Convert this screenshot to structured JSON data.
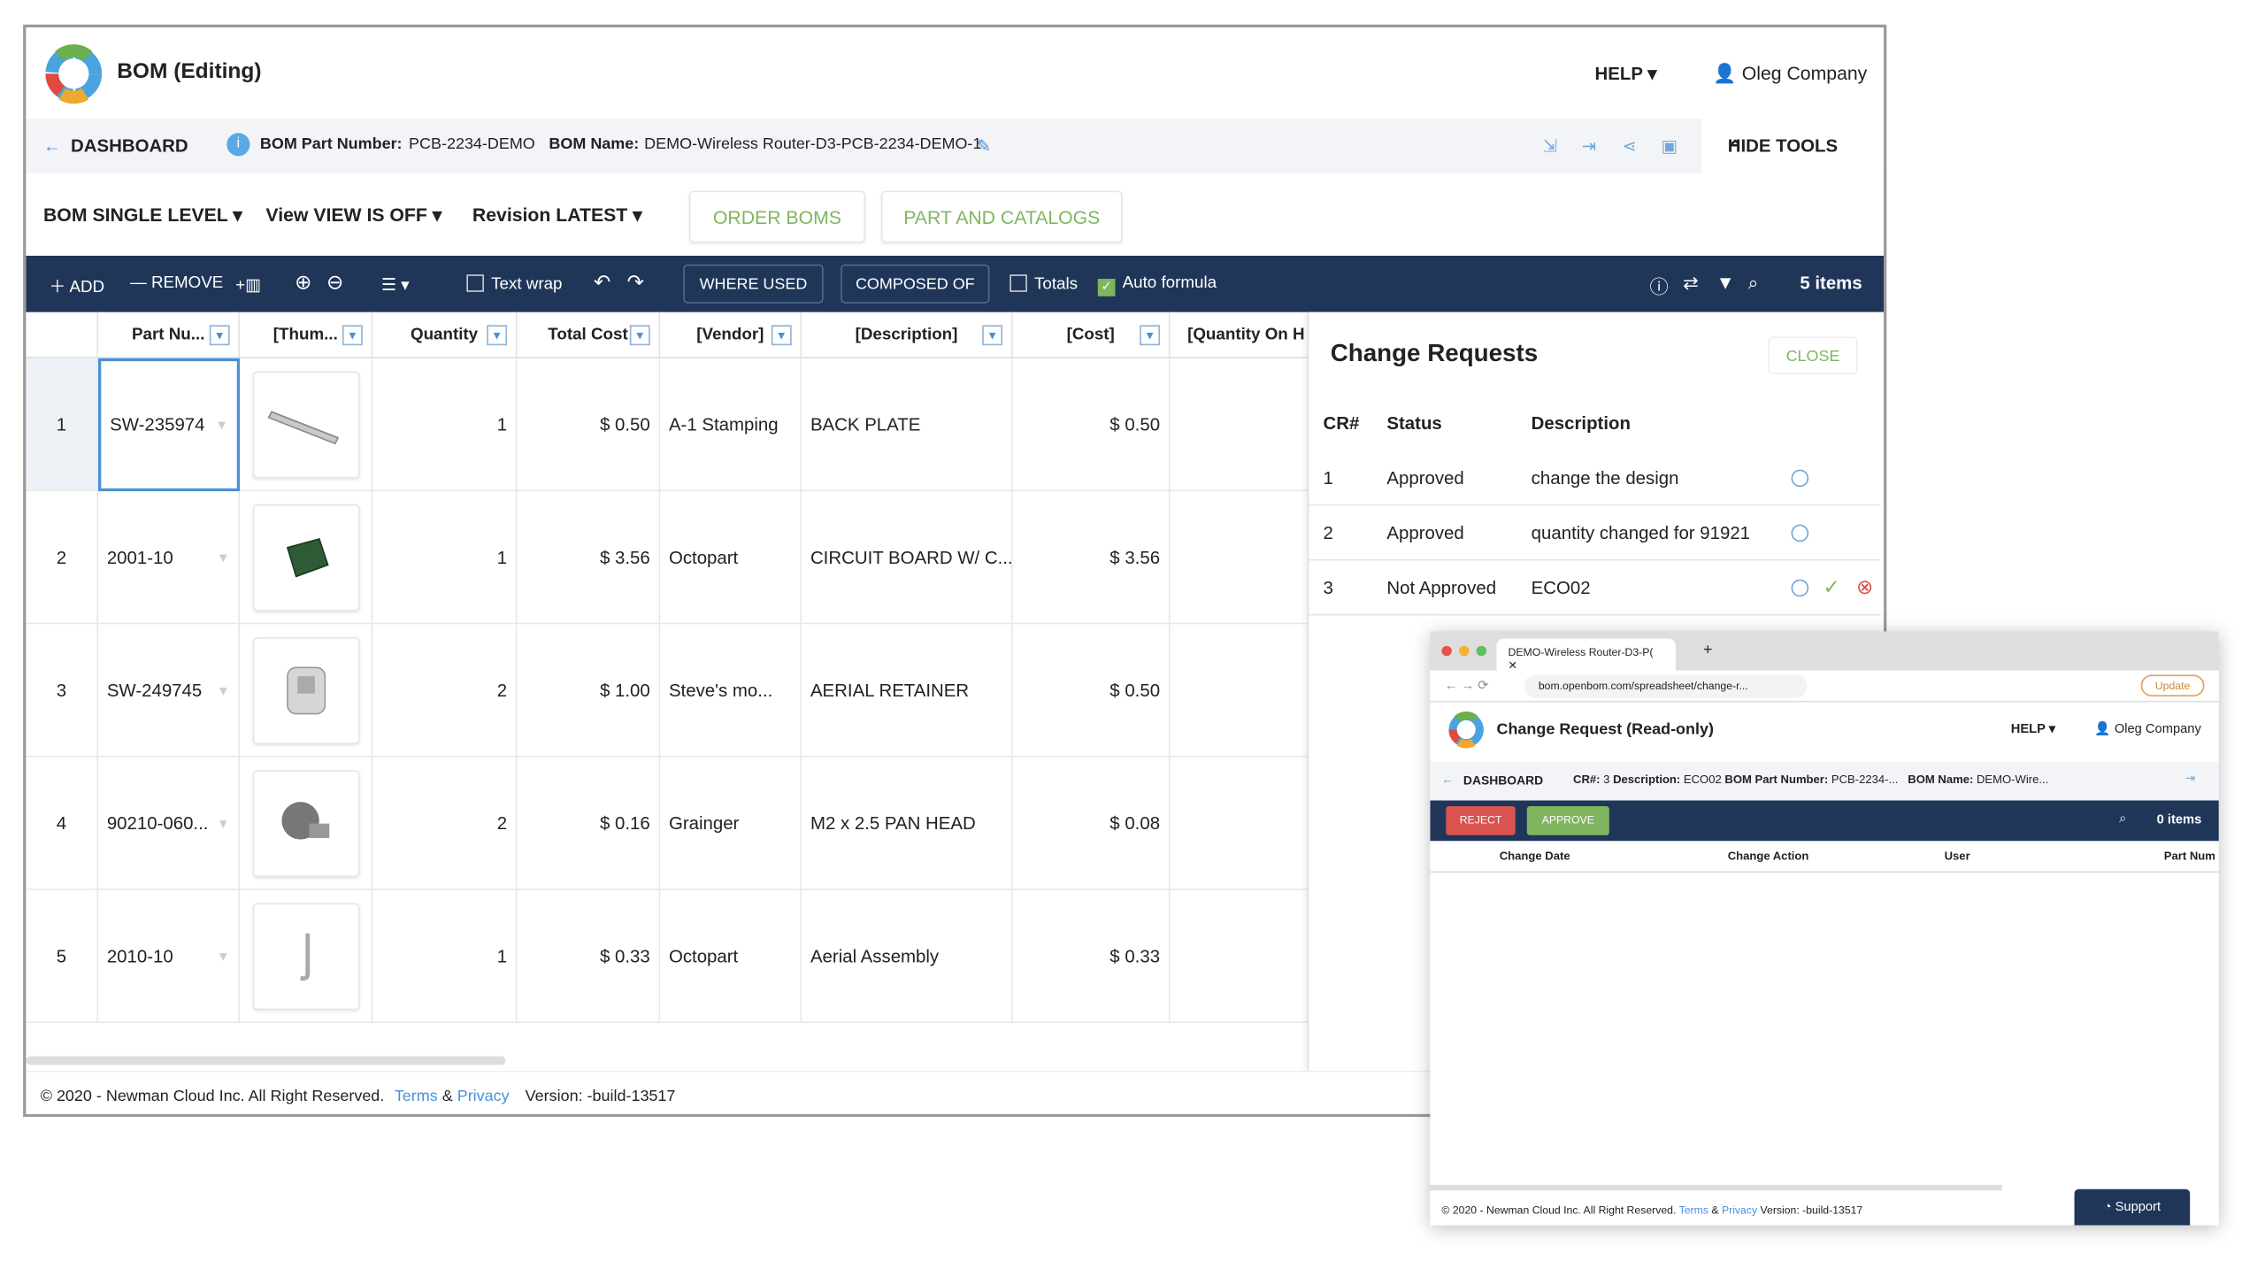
{
  "app": {
    "title": "BOM (Editing)",
    "help": "HELP",
    "user": "Oleg Company"
  },
  "breadcrumb": {
    "back": "DASHBOARD",
    "part_label": "BOM Part Number:",
    "part_value": "PCB-2234-DEMO",
    "name_label": "BOM Name:",
    "name_value": "DEMO-Wireless Router-D3-PCB-2234-DEMO-1",
    "hide_tools": "HIDE TOOLS"
  },
  "options": {
    "bom_label": "BOM",
    "bom_value": "SINGLE LEVEL",
    "view_label": "View",
    "view_value": "VIEW IS OFF",
    "rev_label": "Revision",
    "rev_value": "LATEST",
    "order_boms": "ORDER BOMS",
    "part_catalogs": "PART AND CATALOGS"
  },
  "toolbar": {
    "add": "ADD",
    "remove": "REMOVE",
    "text_wrap": "Text wrap",
    "where_used": "WHERE USED",
    "composed_of": "COMPOSED OF",
    "totals": "Totals",
    "auto_formula": "Auto formula",
    "auto_formula_checked": true,
    "items": "5 items"
  },
  "columns": [
    "Part Nu...",
    "[Thum...",
    "Quantity",
    "Total Cost",
    "[Vendor]",
    "[Description]",
    "[Cost]",
    "[Quantity On H"
  ],
  "rows": [
    {
      "n": "1",
      "part": "SW-235974",
      "qty": "1",
      "total": "$ 0.50",
      "vendor": "A-1 Stamping",
      "desc": "BACK PLATE",
      "cost": "$ 0.50"
    },
    {
      "n": "2",
      "part": "2001-10",
      "qty": "1",
      "total": "$ 3.56",
      "vendor": "Octopart",
      "desc": "CIRCUIT BOARD W/ C...",
      "cost": "$ 3.56"
    },
    {
      "n": "3",
      "part": "SW-249745",
      "qty": "2",
      "total": "$ 1.00",
      "vendor": "Steve's mo...",
      "desc": "AERIAL RETAINER",
      "cost": "$ 0.50"
    },
    {
      "n": "4",
      "part": "90210-060...",
      "qty": "2",
      "total": "$ 0.16",
      "vendor": "Grainger",
      "desc": "M2 x 2.5 PAN HEAD",
      "cost": "$ 0.08"
    },
    {
      "n": "5",
      "part": "2010-10",
      "qty": "1",
      "total": "$ 0.33",
      "vendor": "Octopart",
      "desc": "Aerial Assembly",
      "cost": "$ 0.33"
    }
  ],
  "change_requests": {
    "title": "Change Requests",
    "close": "CLOSE",
    "headers": [
      "CR#",
      "Status",
      "Description"
    ],
    "items": [
      {
        "cr": "1",
        "status": "Approved",
        "desc": "change the design"
      },
      {
        "cr": "2",
        "status": "Approved",
        "desc": "quantity changed for 91921"
      },
      {
        "cr": "3",
        "status": "Not Approved",
        "desc": "ECO02"
      }
    ]
  },
  "footer": {
    "copy": "© 2020 - Newman Cloud Inc. All Right Reserved.",
    "terms": "Terms",
    "amp": "&",
    "privacy": "Privacy",
    "version": "Version: -build-13517"
  },
  "popup": {
    "tab": "DEMO-Wireless Router-D3-P(",
    "url": "bom.openbom.com/spreadsheet/change-r...",
    "update": "Update",
    "title": "Change Request (Read-only)",
    "help": "HELP",
    "user": "Oleg Company",
    "back": "DASHBOARD",
    "cr_label": "CR#:",
    "cr_value": "3",
    "desc_label": "Description:",
    "desc_value": "ECO02",
    "part_label": "BOM Part Number:",
    "part_value": "PCB-2234-...",
    "name_label": "BOM Name:",
    "name_value": "DEMO-Wire...",
    "reject": "REJECT",
    "approve": "APPROVE",
    "items": "0 items",
    "columns": [
      "Change Date",
      "Change Action",
      "User",
      "Part Num"
    ],
    "footer": {
      "copy": "© 2020 - Newman Cloud Inc. All Right Reserved.",
      "terms": "Terms",
      "amp": "&",
      "privacy": "Privacy",
      "version": "Version: -build-13517"
    },
    "support": "Support"
  },
  "colors": {
    "navy": "#1f3658",
    "green": "#7fb55f",
    "link": "#4a90d9",
    "reject": "#d9534f",
    "approve": "#7fb55f"
  }
}
